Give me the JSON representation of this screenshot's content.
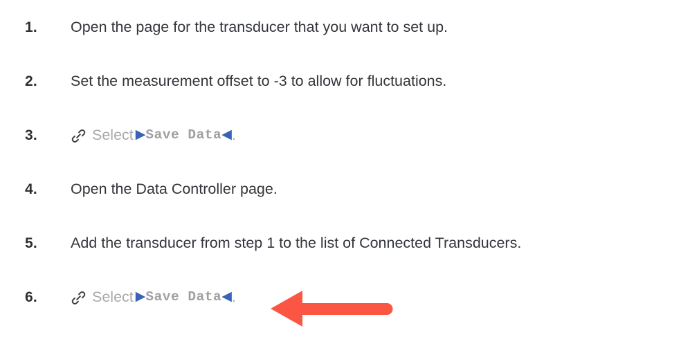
{
  "document": {
    "background_color": "#ffffff",
    "text_color": "#32353a",
    "number_color": "#2f2f2f",
    "muted_text_color": "#a9a9a9",
    "ui_marker_color": "#3a63b8",
    "ui_label_color": "#a0a0a0",
    "annotation_color": "#fb5644"
  },
  "steps": [
    {
      "number": "1.",
      "type": "plain",
      "text": "Open the page for the transducer that you want to set up."
    },
    {
      "number": "2.",
      "type": "plain",
      "text": "Set the measurement offset to -3 to allow for fluctuations."
    },
    {
      "number": "3.",
      "type": "link",
      "icon": "link-icon",
      "verb": "Select",
      "marker_open": "▶",
      "ui_label": "Save Data",
      "marker_close": "◀",
      "period": "."
    },
    {
      "number": "4.",
      "type": "plain",
      "text": "Open the Data Controller page."
    },
    {
      "number": "5.",
      "type": "plain",
      "text": "Add the transducer from step 1 to the list of Connected Transducers."
    },
    {
      "number": "6.",
      "type": "link",
      "icon": "link-icon",
      "verb": "Select",
      "marker_open": "▶",
      "ui_label": "Save Data",
      "marker_close": "◀",
      "period": "."
    }
  ],
  "annotation": {
    "name": "left-pointing-arrow",
    "color": "#fb5644",
    "direction": "left",
    "points_at_step": "6."
  }
}
